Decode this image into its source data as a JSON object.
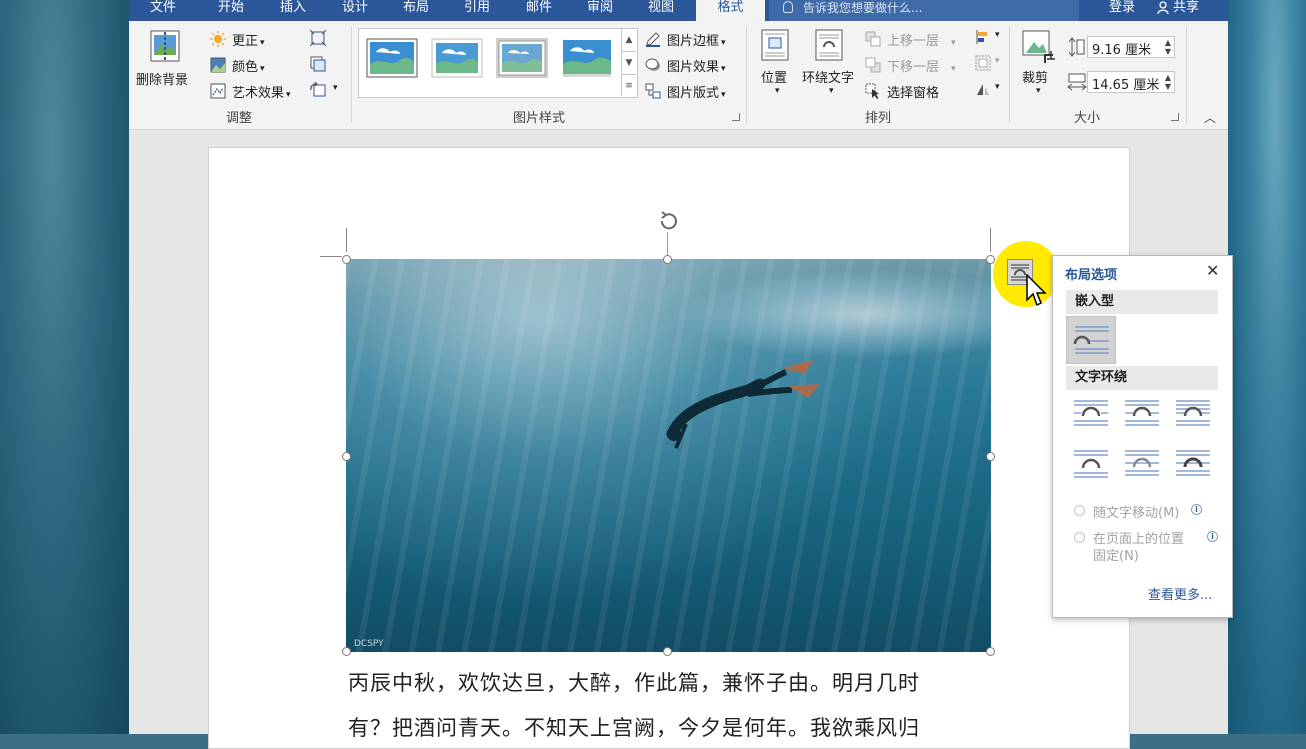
{
  "tabs": [
    "文件",
    "开始",
    "插入",
    "设计",
    "布局",
    "引用",
    "邮件",
    "审阅",
    "视图",
    "格式"
  ],
  "active_tab": "格式",
  "tell_me": "告诉我您想要做什么...",
  "login": "登录",
  "share": "共享",
  "ribbon": {
    "adjust": {
      "remove_bg": "删除背景",
      "correct": "更正",
      "color": "颜色",
      "art": "艺术效果",
      "label": "调整"
    },
    "styles": {
      "border": "图片边框",
      "effects": "图片效果",
      "layout": "图片版式",
      "label": "图片样式"
    },
    "arrange": {
      "position": "位置",
      "wrap": "环绕文字",
      "forward": "上移一层",
      "backward": "下移一层",
      "pane": "选择窗格",
      "label": "排列"
    },
    "size": {
      "crop": "裁剪",
      "height": "9.16 厘米",
      "width": "14.65 厘米",
      "label": "大小"
    }
  },
  "picture": {
    "watermark": "DCSPY"
  },
  "document_lines": [
    "丙辰中秋，欢饮达旦，大醉，作此篇，兼怀子由。明月几时",
    "有？把酒问青天。不知天上宫阙，今夕是何年。我欲乘风归"
  ],
  "panel": {
    "title": "布局选项",
    "inline": "嵌入型",
    "wrap": "文字环绕",
    "move_with_text": "随文字移动(M)",
    "fix_line1": "在页面上的位置",
    "fix_line2": "固定(N)",
    "see_more": "查看更多..."
  },
  "colors": {
    "accent": "#2b579a",
    "highlight": "#ffea00"
  }
}
